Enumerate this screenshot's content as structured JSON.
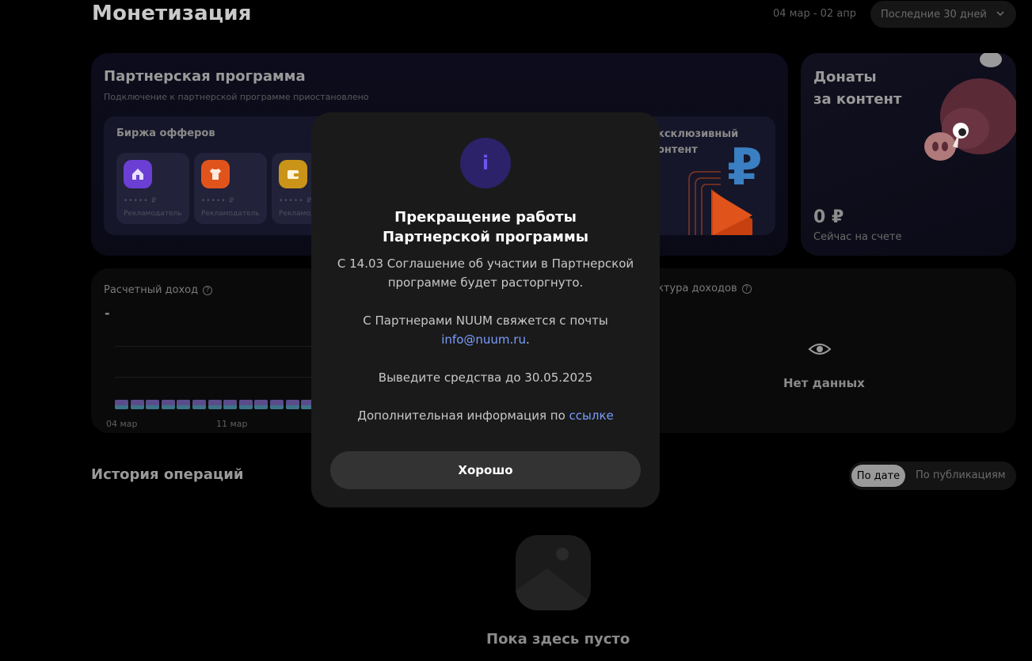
{
  "header": {
    "title": "Монетизация",
    "date_range": "04 мар - 02 апр",
    "period": "Последние 30 дней"
  },
  "partner": {
    "title": "Партнерская программа",
    "subtitle": "Подключение к партнерской программе приостановлено",
    "offers_title": "Биржа офферов",
    "offers": [
      {
        "price": "••••• ₽",
        "role": "Рекламодатель",
        "icon": "house-icon",
        "color": "#6b3fd4"
      },
      {
        "price": "••••• ₽",
        "role": "Рекламодатель",
        "icon": "tshirt-icon",
        "color": "#e0541c"
      },
      {
        "price": "••••• ₽",
        "role": "Рекламод",
        "icon": "wallet-icon",
        "color": "#c99418"
      }
    ],
    "exclusive_line1": "ксклюзивный",
    "exclusive_line2": "онтент"
  },
  "donations": {
    "title_line1": "Донаты",
    "title_line2": "за контент",
    "amount": "0 ₽",
    "sub": "Сейчас на счете"
  },
  "income": {
    "label": "Расчетный доход",
    "value": "-",
    "ticks": [
      "04 мар",
      "11 мар"
    ],
    "structure_label": "ктура доходов",
    "no_data": "Нет данных"
  },
  "history": {
    "title": "История операций",
    "sort_by_date": "По дате",
    "sort_by_publication": "По публикациям",
    "empty": "Пока здесь пусто"
  },
  "modal": {
    "title_line1": "Прекращение работы",
    "title_line2": "Партнерской программы",
    "p1_line1": "С 14.03 Соглашение об участии в Партнерской",
    "p1_line2": "программе будет расторгнуто.",
    "p2_line1": "С Партнерами NUUM свяжется с почты",
    "p2_email": "info@nuum.ru",
    "p2_dot": ".",
    "p3": "Выведите средства до 30.05.2025",
    "p4_text": "Дополнительная информация по ",
    "p4_link": "ссылке",
    "ok": "Хорошо"
  },
  "colors": {
    "accent_link": "#7a9eff",
    "info_bg": "#2b2269",
    "info_fg": "#6b55f0",
    "modal_bg": "#1a1a1a"
  }
}
